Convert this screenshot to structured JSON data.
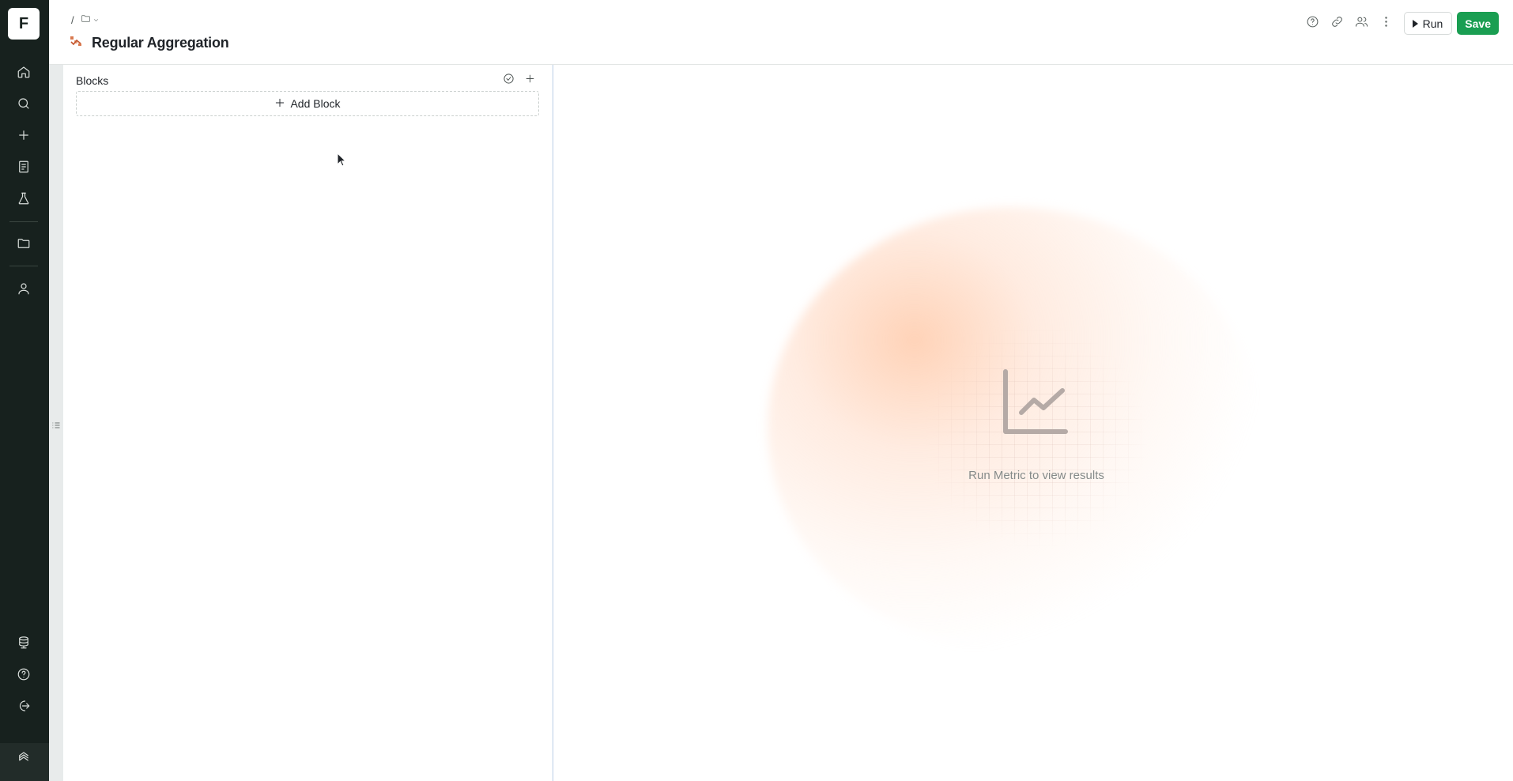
{
  "sidebar": {
    "logo_letter": "F",
    "items": [
      {
        "icon": "home-icon"
      },
      {
        "icon": "search-icon"
      },
      {
        "icon": "plus-icon"
      },
      {
        "icon": "notebook-icon"
      },
      {
        "icon": "flask-icon"
      },
      {
        "icon": "folder-icon"
      },
      {
        "icon": "user-icon"
      }
    ],
    "bottom_items": [
      {
        "icon": "database-icon"
      },
      {
        "icon": "help-icon"
      },
      {
        "icon": "logout-icon"
      },
      {
        "icon": "layers-icon"
      }
    ]
  },
  "header": {
    "breadcrumb_separator": "/",
    "title": "Regular Aggregation",
    "run_label": "Run",
    "save_label": "Save",
    "save_color": "#1a9e52"
  },
  "blocks": {
    "label": "Blocks",
    "add_block_label": "Add Block"
  },
  "results": {
    "empty_message": "Run Metric to view results"
  }
}
